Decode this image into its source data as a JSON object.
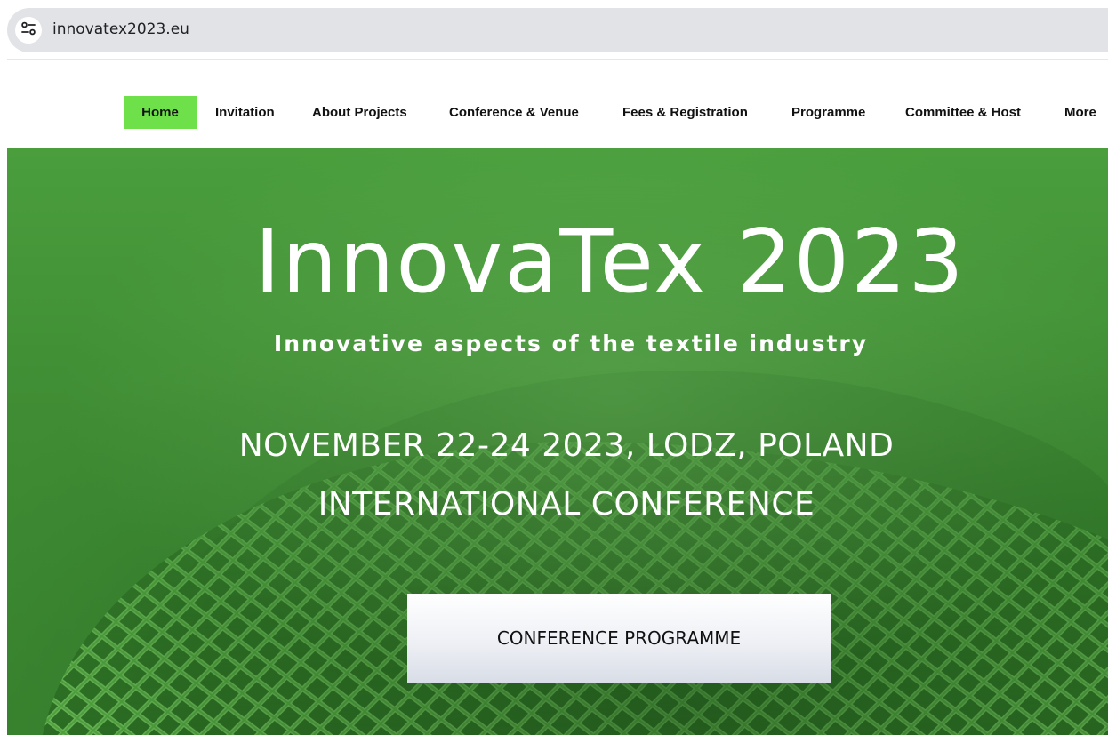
{
  "browser": {
    "url": "innovatex2023.eu",
    "site_info_icon": "tune-icon"
  },
  "nav": {
    "items": [
      {
        "label": "Home",
        "active": true
      },
      {
        "label": "Invitation"
      },
      {
        "label": "About Projects"
      },
      {
        "label": "Conference & Venue"
      },
      {
        "label": "Fees & Registration"
      },
      {
        "label": "Programme"
      },
      {
        "label": "Committee & Host"
      },
      {
        "label": "More"
      }
    ],
    "active_color": "#6ee04a"
  },
  "hero": {
    "title": "InnovaTex 2023",
    "subtitle": "Innovative aspects of the textile industry",
    "date_location": "NOVEMBER 22-24 2023, LODZ, POLAND",
    "event_type": "INTERNATIONAL CONFERENCE",
    "cta_label": "CONFERENCE PROGRAMME",
    "background_color": "#3f8f35"
  }
}
